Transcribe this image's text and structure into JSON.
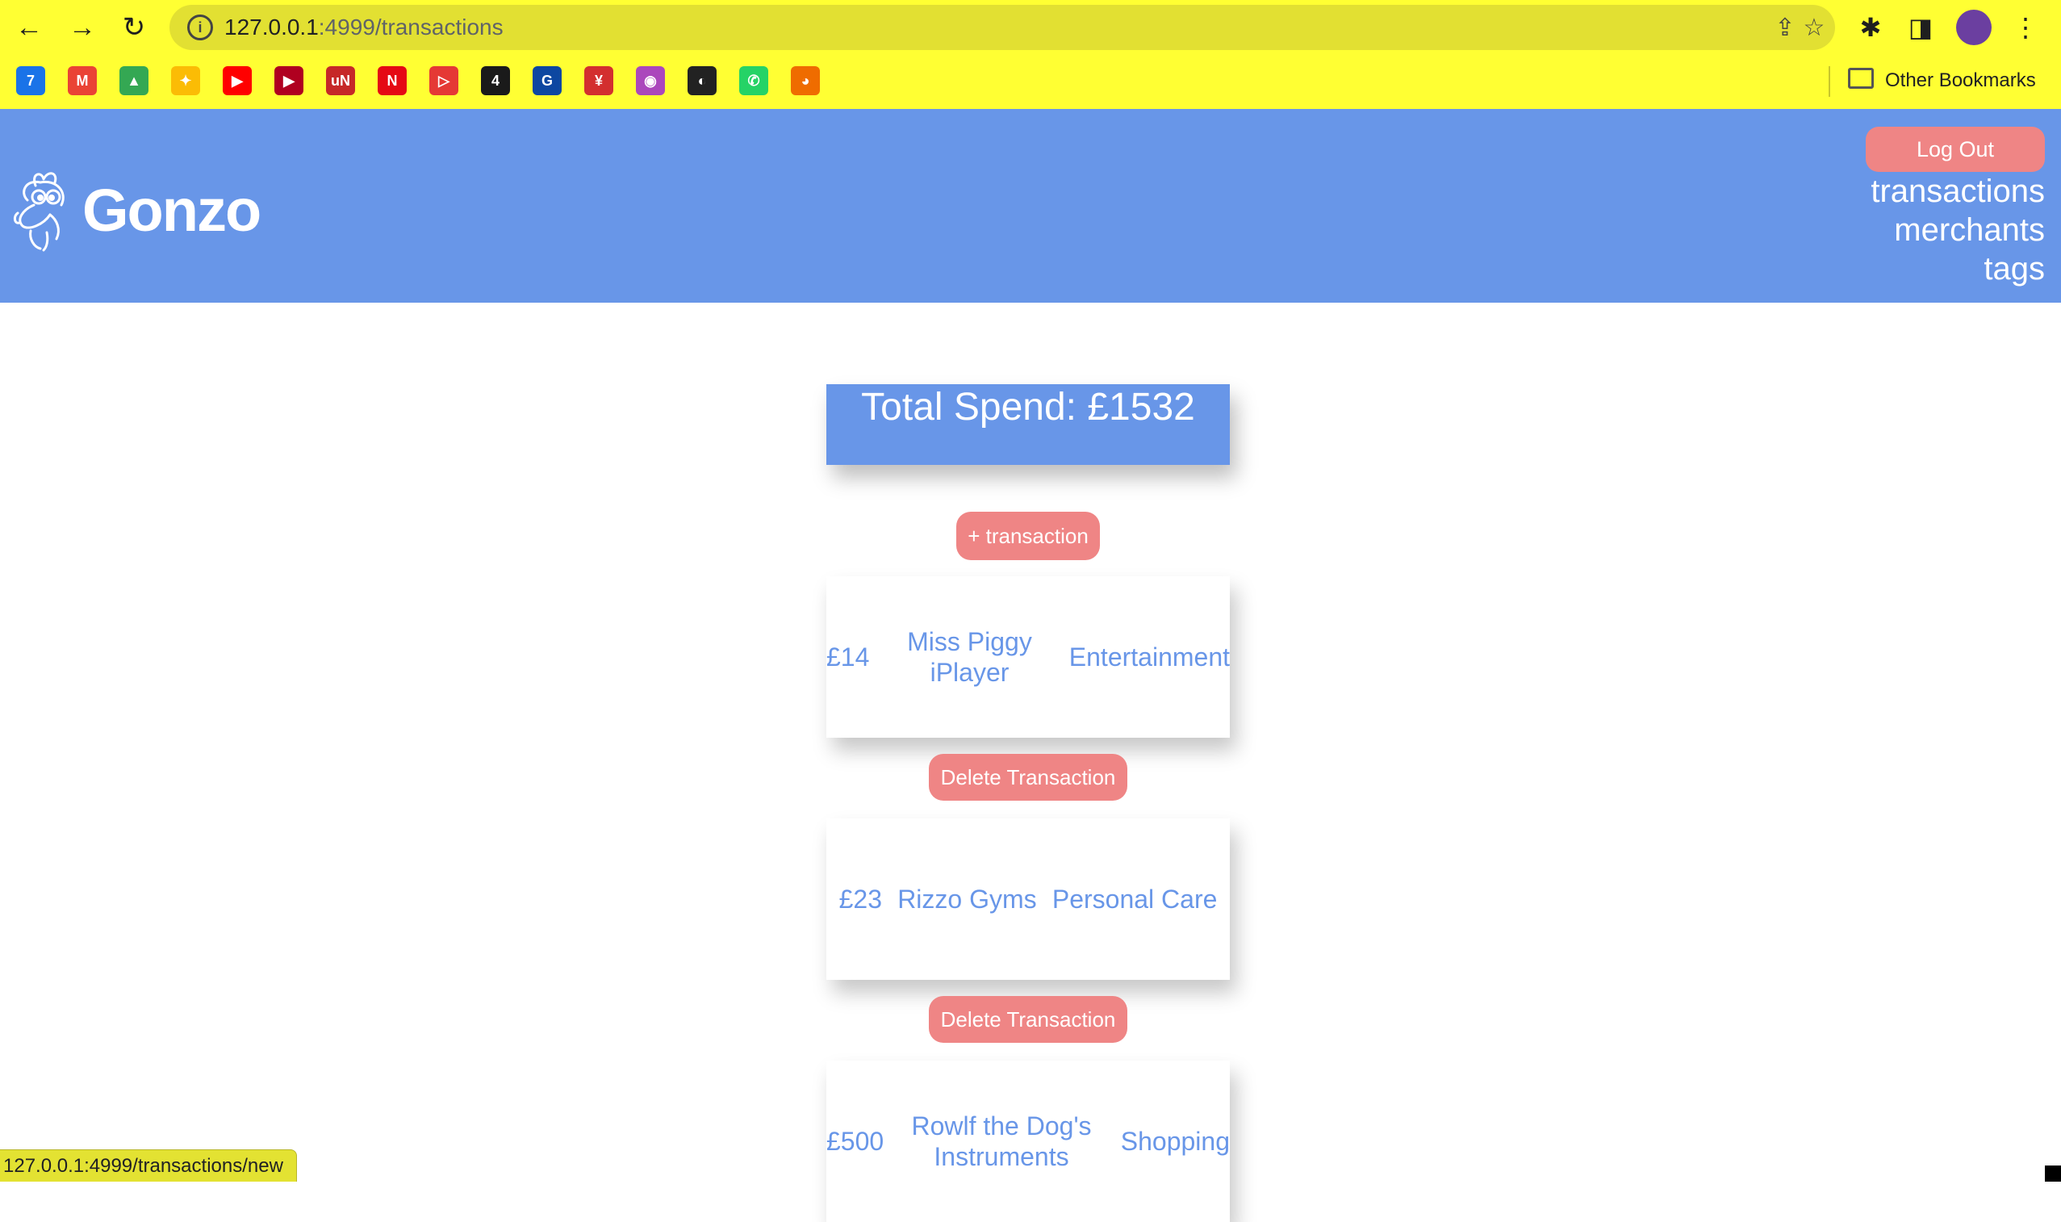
{
  "browser": {
    "url_host": "127.0.0.1",
    "url_path": ":4999/transactions",
    "status_url": "127.0.0.1:4999/transactions/new",
    "bookmarks_other_label": "Other Bookmarks",
    "bookmark_icons": [
      "trello-like-icon",
      "gmail-icon",
      "drive-icon",
      "photos-icon",
      "youtube-icon",
      "play-icon",
      "un-icon",
      "netflix-icon",
      "prime-icon",
      "channel4-icon",
      "g-icon",
      "red-icon",
      "colorful-icon",
      "globe-icon",
      "whatsapp-icon",
      "duck-icon"
    ],
    "bookmark_glyphs": [
      "7",
      "M",
      "▲",
      "✦",
      "▶",
      "▶",
      "uN",
      "N",
      "▷",
      "4",
      "G",
      "¥",
      "◉",
      "◐",
      "✆",
      "◕"
    ],
    "bookmark_colors": [
      "#1a73e8",
      "#ea4335",
      "#34a853",
      "#fbbc05",
      "#ff0000",
      "#b00020",
      "#c62828",
      "#e50914",
      "#e53935",
      "#1a1a1a",
      "#0d47a1",
      "#d32f2f",
      "#ab47bc",
      "#222222",
      "#25d366",
      "#ef6c00"
    ]
  },
  "app": {
    "brand": "Gonzo",
    "logout_label": "Log Out",
    "nav": [
      "transactions",
      "merchants",
      "tags"
    ]
  },
  "main": {
    "total_label": "Total Spend: £1532",
    "add_label": "+ transaction",
    "delete_label": "Delete Transaction",
    "transactions": [
      {
        "amount": "£14",
        "merchant": "Miss Piggy iPlayer",
        "tag": "Entertainment"
      },
      {
        "amount": "£23",
        "merchant": "Rizzo Gyms",
        "tag": "Personal Care"
      },
      {
        "amount": "£500",
        "merchant": "Rowlf the Dog's Instruments",
        "tag": "Shopping"
      }
    ]
  },
  "colors": {
    "browser_bar": "#ffff33",
    "header": "#6896e8",
    "button": "#ef8585",
    "text_accent": "#6896e8"
  }
}
